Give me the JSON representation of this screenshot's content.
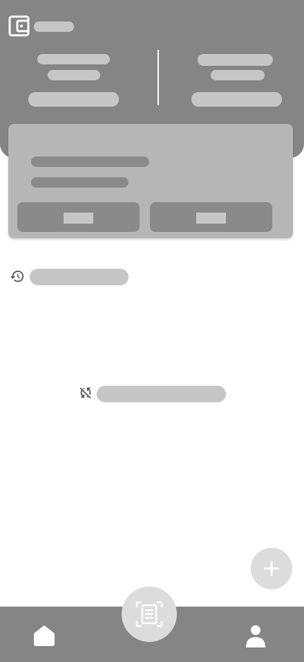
{
  "icons": {
    "wallet": "wallet-icon",
    "history": "history-icon",
    "sync_disabled": "sync-disabled-icon",
    "add": "plus-icon",
    "scan": "document-scanner-icon",
    "home": "home-icon",
    "profile": "person-icon"
  },
  "colors": {
    "header": "#858585",
    "card": "#b6b6b6",
    "placeholder_light": "#c6c6c6",
    "placeholder_dark": "#8a8a8a",
    "fab": "#dcdcdc",
    "nav": "#858585"
  }
}
